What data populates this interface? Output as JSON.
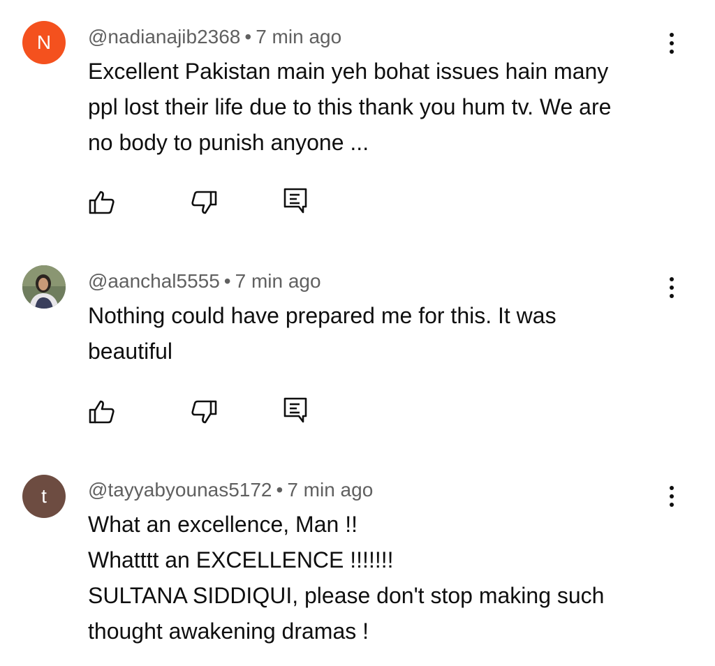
{
  "comments": [
    {
      "handle": "@nadianajib2368",
      "separator": "•",
      "time": "7 min ago",
      "avatar_letter": "N",
      "avatar_color": "#f4511e",
      "lines": [
        "Excellent Pakistan main yeh bohat issues hain many",
        "ppl lost their life due to this thank you hum tv. We are",
        "no body to punish anyone ..."
      ]
    },
    {
      "handle": "@aanchal5555",
      "separator": "•",
      "time": "7 min ago",
      "avatar_letter": "",
      "avatar_color": "#5a6b52",
      "lines": [
        "Nothing could have prepared me for this. It was",
        "beautiful"
      ]
    },
    {
      "handle": "@tayyabyounas5172",
      "separator": "•",
      "time": "7 min ago",
      "avatar_letter": "t",
      "avatar_color": "#6d4c41",
      "lines": [
        "What an excellence, Man !!",
        "Whatttt an EXCELLENCE !!!!!!!",
        "SULTANA SIDDIQUI, please don't stop making such",
        "thought awakening dramas !"
      ]
    }
  ],
  "icons": {
    "like": "thumbs-up-icon",
    "dislike": "thumbs-down-icon",
    "reply": "reply-comment-icon",
    "more": "more-vertical-icon"
  }
}
